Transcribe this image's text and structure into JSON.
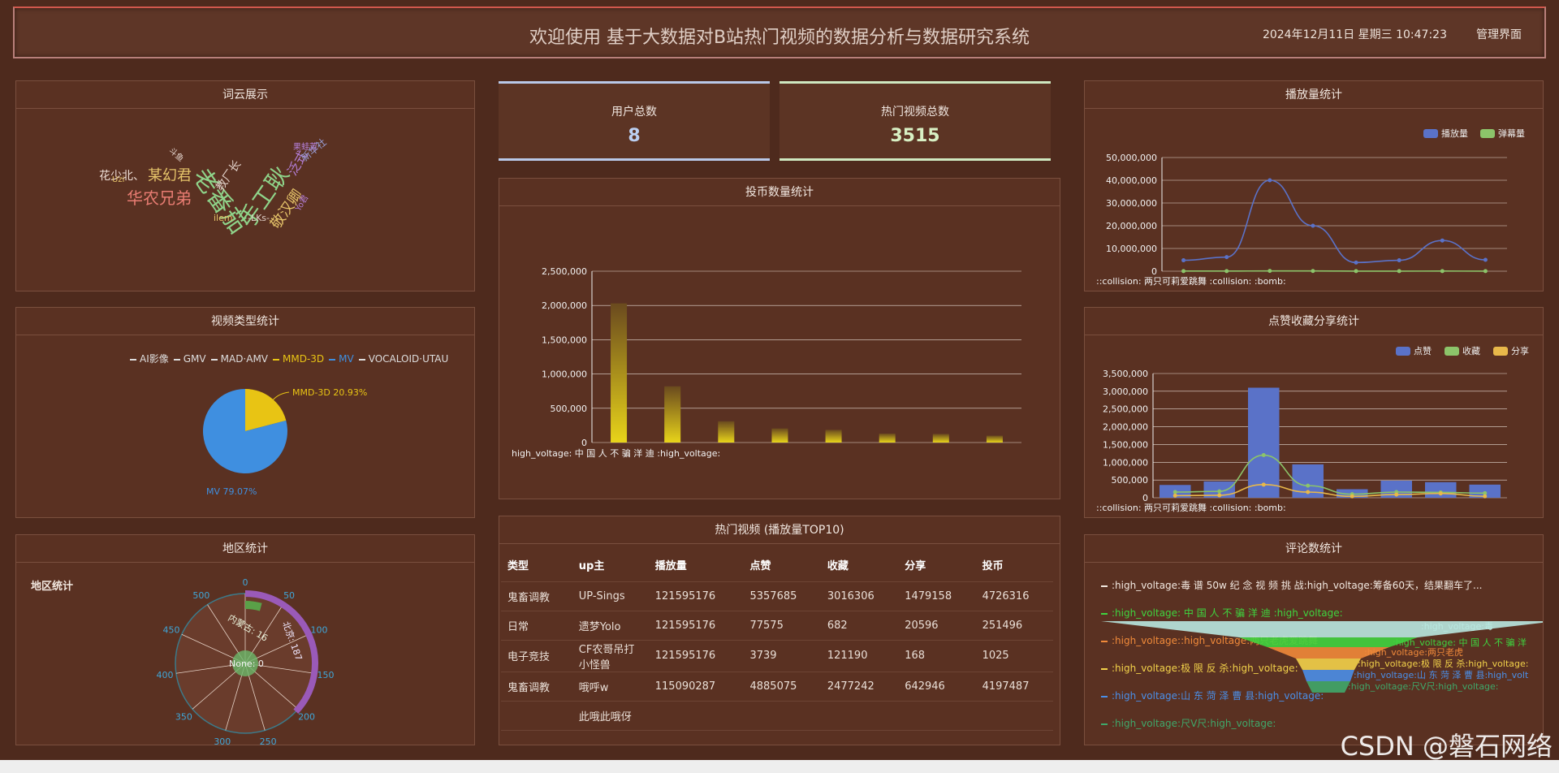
{
  "header": {
    "title": "欢迎使用 基于大数据对B站热门视频的数据分析与数据研究系统",
    "datetime": "2024年12月11日 星期三 10:47:23",
    "admin": "管理界面"
  },
  "wordcloud": {
    "title": "词云展示",
    "words": [
      {
        "t": "花少北、",
        "c": "#f0e0d8",
        "s": 14
      },
      {
        "t": "某幻君",
        "c": "#e6c46a",
        "s": 18
      },
      {
        "t": "华农兄弟",
        "c": "#e87c72",
        "s": 20
      },
      {
        "t": "老番茄",
        "c": "#8fd48a",
        "s": 30
      },
      {
        "t": "手工耿",
        "c": "#8fd48a",
        "s": 28
      },
      {
        "t": "敬汉卿",
        "c": "#e6c46a",
        "s": 18
      },
      {
        "t": "泛式",
        "c": "#b47fd8",
        "s": 16
      },
      {
        "t": "新华社",
        "c": "#9aa0d8",
        "s": 12
      },
      {
        "t": "果蛙苦",
        "c": "#b47fd8",
        "s": 10
      },
      {
        "t": "教厂长",
        "c": "#e0d0c8",
        "s": 14
      },
      {
        "t": "ilem",
        "c": "#e6c46a",
        "s": 11
      },
      {
        "t": "-LKs-",
        "c": "#e0d0c8",
        "s": 11
      },
      {
        "t": "Uzi",
        "c": "#e6c46a",
        "s": 10
      },
      {
        "t": "Yo君",
        "c": "#b47fd8",
        "s": 10
      },
      {
        "t": "斗鱼",
        "c": "#e0d0c8",
        "s": 10
      }
    ]
  },
  "videotype": {
    "title": "视频类型统计",
    "legend": [
      "AI影像",
      "GMV",
      "MAD·AMV",
      "MMD-3D",
      "MV",
      "VOCALOID·UTAU"
    ],
    "slices": [
      {
        "name": "MMD-3D",
        "pct": 20.93,
        "label": "MMD-3D 20.93%",
        "color": "#e8c414"
      },
      {
        "name": "MV",
        "pct": 79.07,
        "label": "MV 79.07%",
        "color": "#3f8fe0"
      }
    ]
  },
  "region": {
    "title": "地区统计",
    "subtitle": "地区统计",
    "ticks": [
      "0",
      "50",
      "100",
      "150",
      "200",
      "250",
      "300",
      "350",
      "400",
      "450",
      "500"
    ],
    "labels": [
      {
        "t": "北京: 187"
      },
      {
        "t": "内蒙古: 16"
      },
      {
        "t": "None: 0"
      }
    ]
  },
  "stats": {
    "users_label": "用户总数",
    "users_value": "8",
    "videos_label": "热门视频总数",
    "videos_value": "3515"
  },
  "coins": {
    "title": "投币数量统计",
    "yticks": [
      "2,500,000",
      "2,000,000",
      "1,500,000",
      "1,000,000",
      "500,000",
      "0"
    ],
    "xlabel": "high_voltage: 中 国 人 不 骗 洋 迪 :high_voltage:",
    "chart_data": {
      "type": "bar",
      "values": [
        2030000,
        820000,
        310000,
        205000,
        185000,
        130000,
        125000,
        100000
      ],
      "ylim": [
        0,
        2500000
      ]
    }
  },
  "top10": {
    "title": "热门视频 (播放量TOP10)",
    "headers": [
      "类型",
      "up主",
      "播放量",
      "点赞",
      "收藏",
      "分享",
      "投币"
    ],
    "rows": [
      [
        "鬼畜调教",
        "UP-Sings",
        "121595176",
        "5357685",
        "3016306",
        "1479158",
        "4726316"
      ],
      [
        "日常",
        "遗梦Yolo",
        "121595176",
        "77575",
        "682",
        "20596",
        "251496"
      ],
      [
        "电子竞技",
        "CF农哥吊打小怪兽",
        "121595176",
        "3739",
        "121190",
        "168",
        "1025"
      ],
      [
        "鬼畜调教",
        "哦呼w",
        "115090287",
        "4885075",
        "2477242",
        "642946",
        "4197487"
      ],
      [
        "",
        "此哦此哦伢",
        "",
        "",
        "",
        "",
        ""
      ]
    ]
  },
  "plays": {
    "title": "播放量统计",
    "legend": [
      "播放量",
      "弹幕量"
    ],
    "yticks": [
      "50,000,000",
      "40,000,000",
      "30,000,000",
      "20,000,000",
      "10,000,000",
      "0"
    ],
    "xlabel": "::collision: 两只可莉爱跳舞 :collision: :bomb:",
    "chart_data": {
      "type": "line",
      "series": [
        {
          "name": "播放量",
          "values": [
            4800000,
            6200000,
            40000000,
            20000000,
            3800000,
            4800000,
            13500000,
            5000000
          ]
        },
        {
          "name": "弹幕量",
          "values": [
            50000,
            60000,
            120000,
            100000,
            40000,
            40000,
            50000,
            40000
          ]
        }
      ],
      "ylim": [
        0,
        50000000
      ]
    }
  },
  "likes": {
    "title": "点赞收藏分享统计",
    "legend": [
      "点赞",
      "收藏",
      "分享"
    ],
    "yticks": [
      "3,500,000",
      "3,000,000",
      "2,500,000",
      "2,000,000",
      "1,500,000",
      "1,000,000",
      "500,000",
      "0"
    ],
    "xlabel": "::collision: 两只可莉爱跳舞 :collision: :bomb:",
    "chart_data": {
      "type": "bar",
      "series": [
        {
          "name": "点赞",
          "values": [
            360000,
            460000,
            3100000,
            940000,
            240000,
            480000,
            440000,
            370000
          ]
        },
        {
          "name": "收藏",
          "values": [
            160000,
            180000,
            1200000,
            340000,
            100000,
            160000,
            150000,
            130000
          ]
        },
        {
          "name": "分享",
          "values": [
            60000,
            70000,
            370000,
            160000,
            40000,
            90000,
            120000,
            40000
          ]
        }
      ],
      "ylim": [
        0,
        3500000
      ]
    }
  },
  "comments": {
    "title": "评论数统计",
    "legend": [
      {
        "t": ":high_voltage:毒 谱 50w 纪 念 视 频 挑 战:high_voltage:筹备60天，结果翻车了...",
        "c": "#f2e8e0"
      },
      {
        "t": ":high_voltage: 中 国 人 不 骗 洋 迪 :high_voltage:",
        "c": "#3fd43f"
      },
      {
        "t": ":high_voltage::high_voltage:两只老虎爱跳舞",
        "c": "#f08a3a"
      },
      {
        "t": ":high_voltage:极 限 反 杀:high_voltage:",
        "c": "#f2d24a"
      },
      {
        "t": ":high_voltage:山 东 菏 泽 曹 县:high_voltage:",
        "c": "#4a8fe8"
      },
      {
        "t": ":high_voltage:尺V尺:high_voltage:",
        "c": "#3fa86a"
      }
    ],
    "funnel_labels": [
      ":high_voltage:毒",
      ":high_voltage: 中 国 人 不 骗 洋",
      ":high_voltage:两只老虎",
      ":high_voltage:极 限 反 杀:high_voltage:",
      ":high_voltage:山 东 菏 泽 曹 县:high_volt",
      ":high_voltage:尺V尺:high_voltage:"
    ]
  },
  "watermark": "CSDN @磐石网络"
}
